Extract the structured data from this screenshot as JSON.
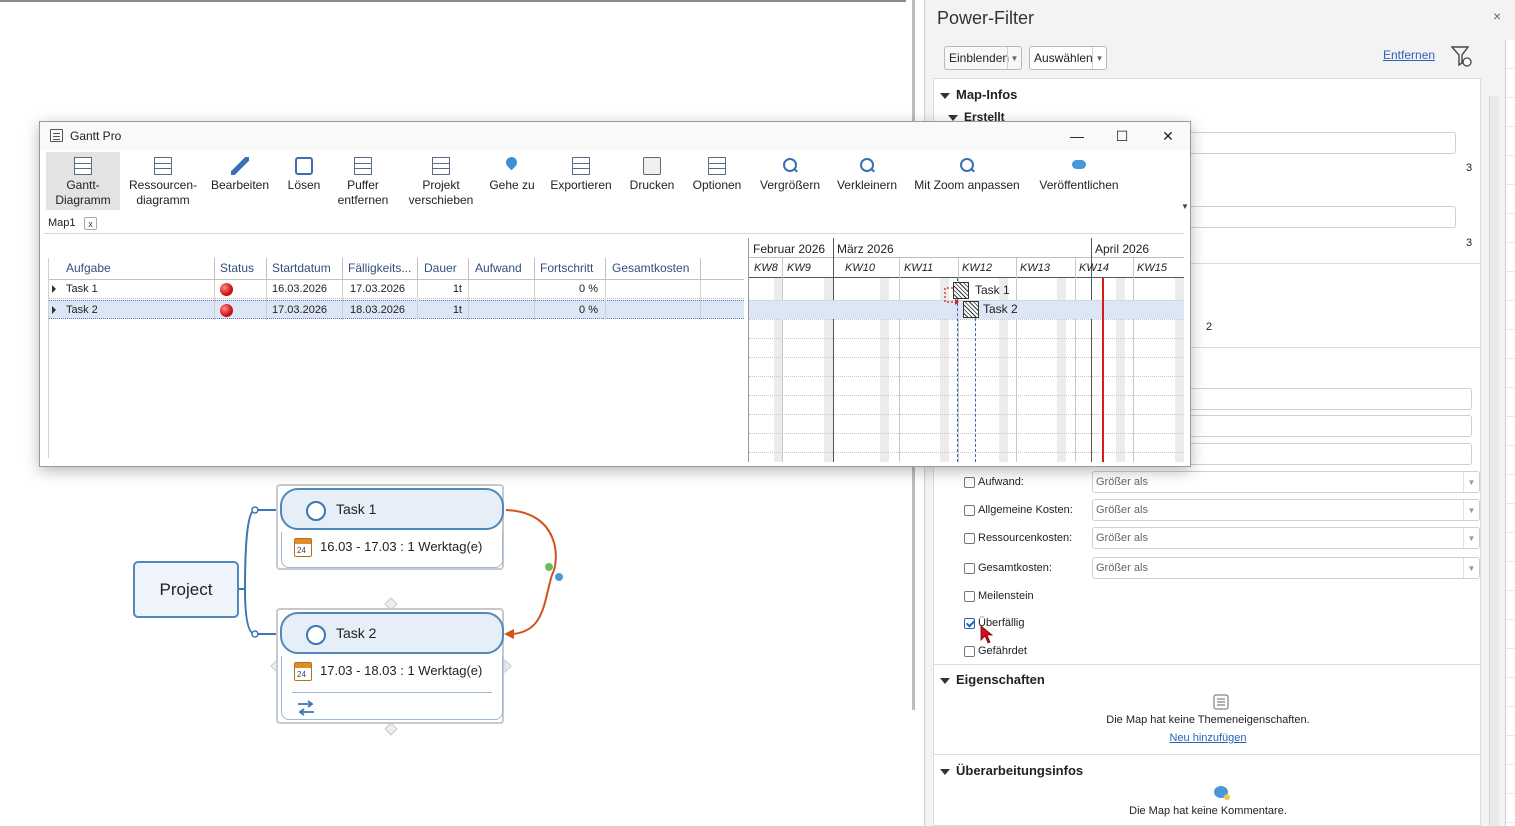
{
  "gantt_window": {
    "title": "Gantt Pro",
    "minimize": "—",
    "maximize": "☐",
    "close": "✕",
    "ribbon": [
      {
        "label": "Gantt-\nDiagramm",
        "icon": "gantt-chart-icon"
      },
      {
        "label": "Ressourcen-\ndiagramm",
        "icon": "resource-chart-icon"
      },
      {
        "label": "Bearbeiten",
        "icon": "pencil-icon"
      },
      {
        "label": "Lösen",
        "icon": "puzzle-icon"
      },
      {
        "label": "Puffer\nentfernen",
        "icon": "remove-buffer-icon"
      },
      {
        "label": "Projekt\nverschieben",
        "icon": "move-project-icon"
      },
      {
        "label": "Gehe zu",
        "icon": "location-pin-icon"
      },
      {
        "label": "Exportieren",
        "icon": "export-icon"
      },
      {
        "label": "Drucken",
        "icon": "printer-icon"
      },
      {
        "label": "Optionen",
        "icon": "options-icon"
      },
      {
        "label": "Vergrößern",
        "icon": "zoom-in-icon"
      },
      {
        "label": "Verkleinern",
        "icon": "zoom-out-icon"
      },
      {
        "label": "Mit Zoom anpassen",
        "icon": "zoom-fit-icon"
      },
      {
        "label": "Veröffentlichen",
        "icon": "cloud-publish-icon"
      }
    ],
    "tab": {
      "label": "Map1",
      "close": "x"
    },
    "columns": [
      "Aufgabe",
      "Status",
      "Startdatum",
      "Fälligkeits...",
      "Dauer",
      "Aufwand",
      "Fortschritt",
      "Gesamtkosten"
    ],
    "rows": [
      {
        "task": "Task 1",
        "status_color": "#d11a1a",
        "start": "16.03.2026",
        "due": "17.03.2026",
        "duration": "1t",
        "effort": "",
        "progress": "0 %",
        "cost": ""
      },
      {
        "task": "Task 2",
        "status_color": "#d11a1a",
        "start": "17.03.2026",
        "due": "18.03.2026",
        "duration": "1t",
        "effort": "",
        "progress": "0 %",
        "cost": ""
      }
    ],
    "timeline": {
      "months": [
        "Februar 2026",
        "März 2026",
        "April 2026"
      ],
      "weeks": [
        "KW8",
        "KW9",
        "KW10",
        "KW11",
        "KW12",
        "KW13",
        "KW14",
        "KW15"
      ],
      "bars": [
        "Task 1",
        "Task 2"
      ]
    }
  },
  "map": {
    "root": "Project",
    "tasks": [
      {
        "label": "Task 1",
        "dates": "16.03 - 17.03 : 1 Werktag(e)",
        "cal_day": "24"
      },
      {
        "label": "Task 2",
        "dates": "17.03 - 18.03 : 1 Werktag(e)",
        "cal_day": "24"
      }
    ]
  },
  "panel": {
    "title": "Power-Filter",
    "close": "×",
    "show_button": "Einblenden",
    "select_button": "Auswählen",
    "remove_link": "Entfernen",
    "map_info": {
      "heading": "Map-Infos",
      "sub": "Erstellt",
      "count1": "3",
      "count2": "3",
      "count3": "2"
    },
    "filters": [
      {
        "label": "Aufwand:",
        "value": "Größer als",
        "checked": false
      },
      {
        "label": "Allgemeine Kosten:",
        "value": "Größer als",
        "checked": false
      },
      {
        "label": "Ressourcenkosten:",
        "value": "Größer als",
        "checked": false
      },
      {
        "label": "Gesamtkosten:",
        "value": "Größer als",
        "checked": false
      },
      {
        "label": "Meilenstein",
        "value": "",
        "checked": false
      },
      {
        "label": "Überfällig",
        "value": "",
        "checked": true
      },
      {
        "label": "Gefährdet",
        "value": "",
        "checked": false
      }
    ],
    "properties": {
      "heading": "Eigenschaften",
      "text": "Die Map hat keine Themeneigenschaften.",
      "link": "Neu hinzufügen"
    },
    "revision": {
      "heading": "Überarbeitungsinfos",
      "text": "Die Map hat keine Kommentare."
    }
  }
}
